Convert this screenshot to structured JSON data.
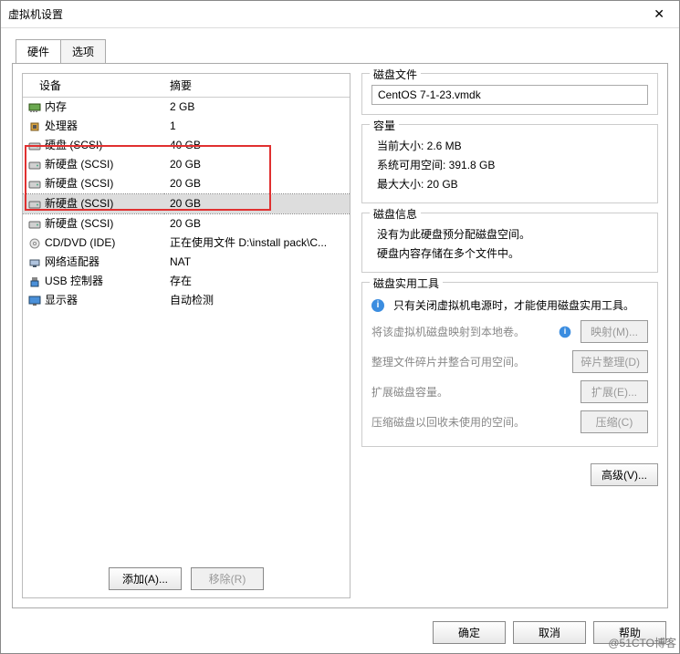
{
  "window": {
    "title": "虚拟机设置"
  },
  "tabs": {
    "hardware": "硬件",
    "options": "选项"
  },
  "table": {
    "headers": {
      "device": "设备",
      "summary": "摘要"
    },
    "rows": [
      {
        "icon": "memory",
        "name": "内存",
        "summary": "2 GB"
      },
      {
        "icon": "cpu",
        "name": "处理器",
        "summary": "1"
      },
      {
        "icon": "disk",
        "name": "硬盘 (SCSI)",
        "summary": "40 GB"
      },
      {
        "icon": "disk",
        "name": "新硬盘 (SCSI)",
        "summary": "20 GB"
      },
      {
        "icon": "disk",
        "name": "新硬盘 (SCSI)",
        "summary": "20 GB"
      },
      {
        "icon": "disk",
        "name": "新硬盘 (SCSI)",
        "summary": "20 GB",
        "selected": true
      },
      {
        "icon": "disk",
        "name": "新硬盘 (SCSI)",
        "summary": "20 GB"
      },
      {
        "icon": "cd",
        "name": "CD/DVD (IDE)",
        "summary": "正在使用文件 D:\\install pack\\C..."
      },
      {
        "icon": "net",
        "name": "网络适配器",
        "summary": "NAT"
      },
      {
        "icon": "usb",
        "name": "USB 控制器",
        "summary": "存在"
      },
      {
        "icon": "display",
        "name": "显示器",
        "summary": "自动检测"
      }
    ]
  },
  "buttons": {
    "add": "添加(A)...",
    "remove": "移除(R)"
  },
  "disk_file": {
    "title": "磁盘文件",
    "value": "CentOS 7-1-23.vmdk"
  },
  "capacity": {
    "title": "容量",
    "current": "当前大小: 2.6 MB",
    "free": "系统可用空间: 391.8 GB",
    "max": "最大大小: 20 GB"
  },
  "disk_info": {
    "title": "磁盘信息",
    "line1": "没有为此硬盘预分配磁盘空间。",
    "line2": "硬盘内容存储在多个文件中。"
  },
  "utils": {
    "title": "磁盘实用工具",
    "hint": "只有关闭虚拟机电源时，才能使用磁盘实用工具。",
    "map_desc": "将该虚拟机磁盘映射到本地卷。",
    "map_btn": "映射(M)...",
    "defrag_desc": "整理文件碎片并整合可用空间。",
    "defrag_btn": "碎片整理(D)",
    "expand_desc": "扩展磁盘容量。",
    "expand_btn": "扩展(E)...",
    "compress_desc": "压缩磁盘以回收未使用的空间。",
    "compress_btn": "压缩(C)"
  },
  "advanced": "高级(V)...",
  "footer": {
    "ok": "确定",
    "cancel": "取消",
    "help": "帮助"
  },
  "watermark": "@51CTO博客"
}
